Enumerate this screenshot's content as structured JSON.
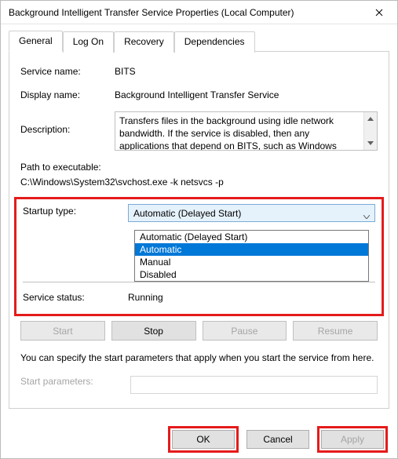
{
  "window": {
    "title": "Background Intelligent Transfer Service Properties (Local Computer)"
  },
  "tabs": {
    "general": "General",
    "logon": "Log On",
    "recovery": "Recovery",
    "dependencies": "Dependencies"
  },
  "labels": {
    "service_name": "Service name:",
    "display_name": "Display name:",
    "description": "Description:",
    "path": "Path to executable:",
    "startup_type": "Startup type:",
    "service_status": "Service status:",
    "help": "You can specify the start parameters that apply when you start the service from here.",
    "start_params": "Start parameters:"
  },
  "values": {
    "service_name": "BITS",
    "display_name": "Background Intelligent Transfer Service",
    "description": "Transfers files in the background using idle network bandwidth. If the service is disabled, then any applications that depend on BITS, such as Windows",
    "path": "C:\\Windows\\System32\\svchost.exe -k netsvcs -p",
    "startup_selected": "Automatic (Delayed Start)",
    "service_status": "Running"
  },
  "startup_options": {
    "o0": "Automatic (Delayed Start)",
    "o1": "Automatic",
    "o2": "Manual",
    "o3": "Disabled"
  },
  "buttons": {
    "start": "Start",
    "stop": "Stop",
    "pause": "Pause",
    "resume": "Resume",
    "ok": "OK",
    "cancel": "Cancel",
    "apply": "Apply"
  }
}
